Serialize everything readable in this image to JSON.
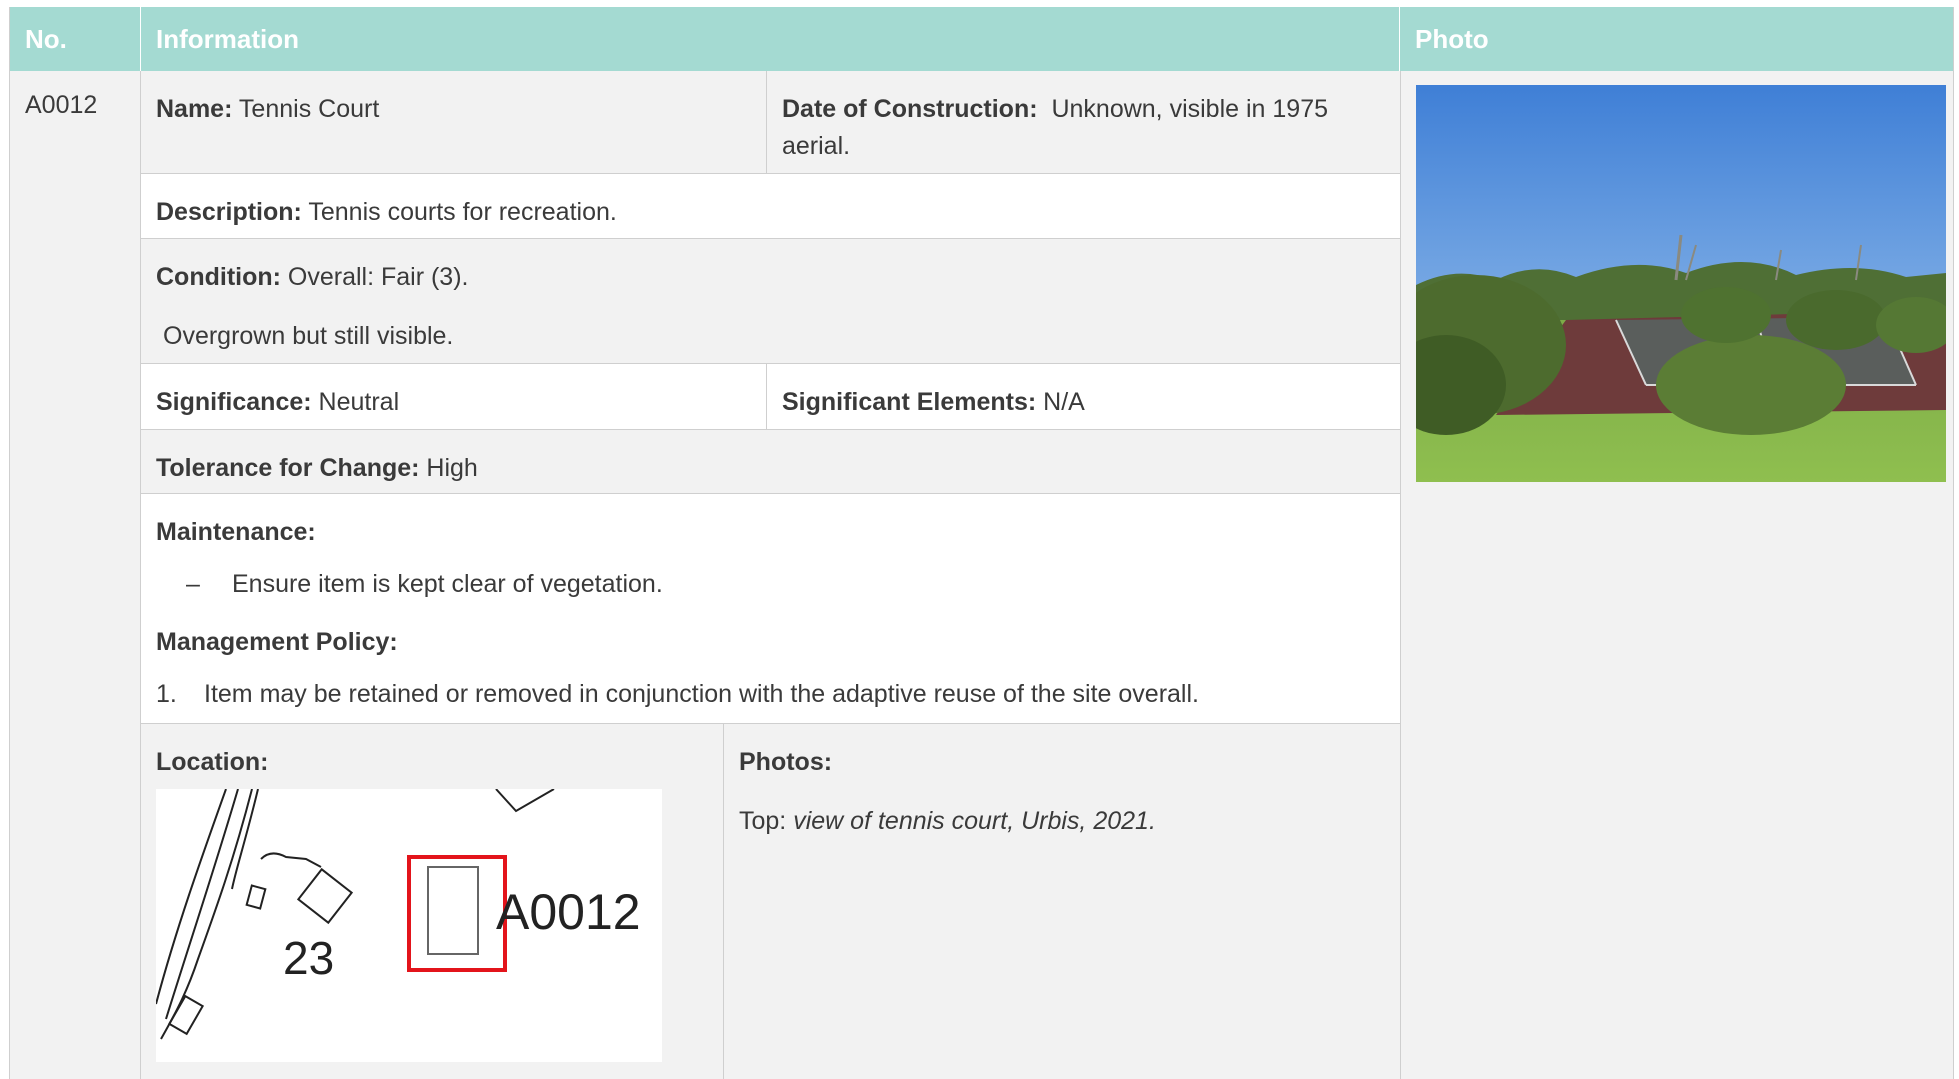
{
  "header": {
    "no": "No.",
    "information": "Information",
    "photo": "Photo"
  },
  "item": {
    "number": "A0012",
    "name_label": "Name:",
    "name_value": "Tennis Court",
    "date_label": "Date of Construction:",
    "date_value": "Unknown, visible in 1975 aerial.",
    "description_label": "Description:",
    "description_value": "Tennis courts for recreation.",
    "condition_label": "Condition:",
    "condition_value": "Overall: Fair (3).",
    "condition_note": "Overgrown but still visible.",
    "significance_label": "Significance:",
    "significance_value": "Neutral",
    "elements_label": "Significant Elements:",
    "elements_value": "N/A",
    "tolerance_label": "Tolerance for Change:",
    "tolerance_value": "High",
    "maintenance_label": "Maintenance:",
    "maintenance_bullet": "–",
    "maintenance_item": "Ensure item is kept clear of vegetation.",
    "policy_label": "Management Policy:",
    "policy_number": "1.",
    "policy_item": "Item may be retained or removed in conjunction with the adaptive reuse of the site overall.",
    "location_label": "Location:",
    "photos_label": "Photos:",
    "photos_prefix": "Top:",
    "photos_caption": "view of tennis court, Urbis, 2021."
  },
  "map": {
    "site_label": "A0012",
    "lot_label": "23",
    "highlight_color": "#e3141b"
  },
  "colors": {
    "header_bg": "#a4dad2",
    "row_grey": "#f2f2f2"
  }
}
